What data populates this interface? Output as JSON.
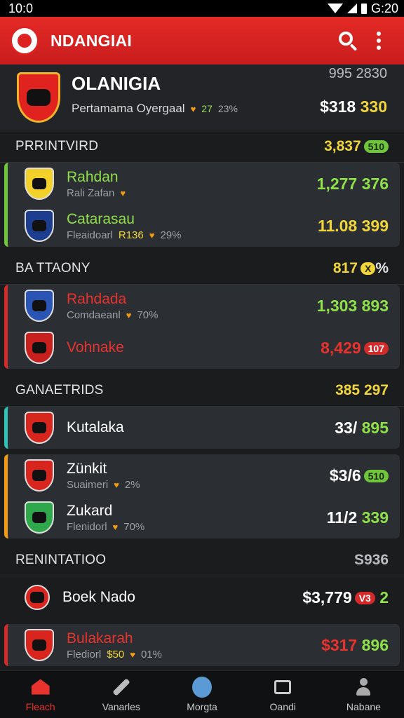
{
  "status": {
    "time_left": "10:0",
    "time_right": "G:20"
  },
  "app": {
    "title": "NDANGIAI"
  },
  "league": {
    "name": "OLANIGIA",
    "subtitle": "Pertamama Oyergaal",
    "change": "27",
    "pct": "23%",
    "meta": "995 2830",
    "price": "$318",
    "price_highlight": "330"
  },
  "sections": [
    {
      "label": "PRRINTVIRD",
      "value": "3,837",
      "badge": "510",
      "badge_color": "green",
      "accent": "green",
      "teams": [
        {
          "name": "Rahdan",
          "sub": "Rali Zafan",
          "sub_extra": "",
          "pct": "",
          "value": "1,277 376",
          "color": "green",
          "crest": "#f2d12a"
        },
        {
          "name": "Catarasau",
          "sub": "Fleaidoarl",
          "sub_extra": "R136",
          "pct": "29%",
          "value": "11.08 399",
          "color": "yellow",
          "crest": "#1d3d8f"
        }
      ]
    },
    {
      "label": "BA TTAONY",
      "value": "817",
      "badge": "X",
      "badge_color": "yellow",
      "badge_suffix": "%",
      "accent": "red",
      "teams": [
        {
          "name": "Rahdada",
          "sub": "Comdaeanl",
          "sub_extra": "",
          "pct": "70%",
          "value": "1,303 893",
          "color": "green",
          "crest": "#2b55b5"
        },
        {
          "name": "Vohnake",
          "sub": "",
          "sub_extra": "",
          "pct": "",
          "value": "8,429",
          "badge": "107",
          "color": "white",
          "crest": "#c8211d"
        }
      ]
    },
    {
      "label": "GANAETRIDS",
      "value": "385 297",
      "accent": "teal",
      "teams": [
        {
          "name": "Kutalaka",
          "sub": "",
          "sub_extra": "",
          "pct": "",
          "value": "33/",
          "value_extra": "895",
          "color": "white",
          "crest": "#d8261f"
        }
      ]
    },
    {
      "label": "",
      "value": "",
      "accent": "orange",
      "teams": [
        {
          "name": "Zünkit",
          "sub": "Suaimeri",
          "sub_extra": "",
          "pct": "2%",
          "value": "$3/6",
          "badge": "510",
          "color": "white",
          "crest": "#d8261f"
        },
        {
          "name": "Zukard",
          "sub": "Flenidorl",
          "sub_extra": "",
          "pct": "70%",
          "value": "11/2",
          "value_extra": "339",
          "color": "white",
          "crest": "#2ea84a"
        }
      ]
    },
    {
      "label": "RENINTATIOO",
      "value": "S936",
      "accent": "none",
      "teams": [
        {
          "name": "Boek Nado",
          "sub": "",
          "sub_extra": "",
          "pct": "",
          "value": "$3,779",
          "badge": "V3",
          "value_extra": "2",
          "color": "white",
          "crest": "#d8261f"
        }
      ]
    },
    {
      "label": "",
      "value": "",
      "accent": "red",
      "teams": [
        {
          "name": "Bulakarah",
          "sub": "Flediorl",
          "sub_extra": "$50",
          "pct": "01%",
          "value": "$317",
          "value_extra": "896",
          "color": "white",
          "crest": "#d8261f"
        }
      ]
    }
  ],
  "nav": [
    {
      "label": "Fleach",
      "icon": "home-icon",
      "active": true
    },
    {
      "label": "Vanarles",
      "icon": "tools-icon",
      "active": false
    },
    {
      "label": "Morgta",
      "icon": "chat-bubble-icon",
      "active": false
    },
    {
      "label": "Oandi",
      "icon": "message-icon",
      "active": false
    },
    {
      "label": "Nabane",
      "icon": "profile-icon",
      "active": false
    }
  ],
  "colors": {
    "accent": "#e42a26",
    "green": "#8fe04a",
    "yellow": "#f0d63a"
  }
}
